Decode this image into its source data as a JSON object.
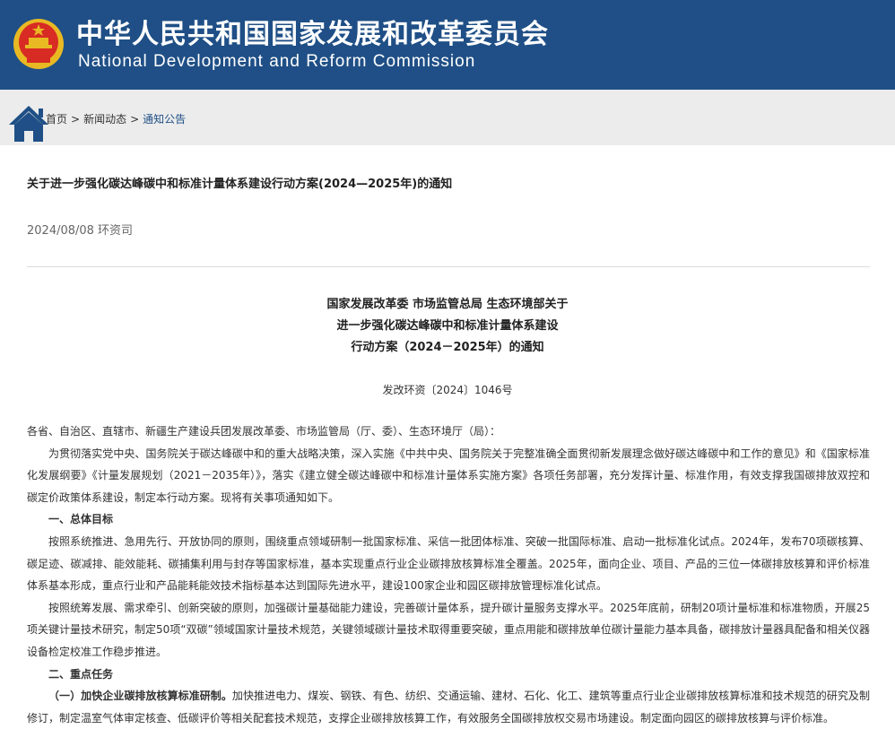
{
  "header": {
    "title_cn": "中华人民共和国国家发展和改革委员会",
    "title_en": "National Development and Reform Commission"
  },
  "breadcrumb": {
    "home": "首页",
    "sep": ">",
    "news": "新闻动态",
    "current": "通知公告"
  },
  "article": {
    "title": "关于进一步强化碳达峰碳中和标准计量体系建设行动方案(2024—2025年)的通知",
    "meta": "2024/08/08 环资司",
    "heading_lines": [
      "国家发展改革委 市场监管总局 生态环境部关于",
      "进一步强化碳达峰碳中和标准计量体系建设",
      "行动方案（2024－2025年）的通知"
    ],
    "doc_no": "发改环资〔2024〕1046号",
    "addressee": "各省、自治区、直辖市、新疆生产建设兵团发展改革委、市场监管局（厅、委）、生态环境厅（局）：",
    "intro": "为贯彻落实党中央、国务院关于碳达峰碳中和的重大战略决策，深入实施《中共中央、国务院关于完整准确全面贯彻新发展理念做好碳达峰碳中和工作的意见》和《国家标准化发展纲要》《计量发展规划（2021－2035年）》，落实《建立健全碳达峰碳中和标准计量体系实施方案》各项任务部署，充分发挥计量、标准作用，有效支撑我国碳排放双控和碳定价政策体系建设，制定本行动方案。现将有关事项通知如下。",
    "section1": "一、总体目标",
    "para1": "按照系统推进、急用先行、开放协同的原则，围绕重点领域研制一批国家标准、采信一批团体标准、突破一批国际标准、启动一批标准化试点。2024年，发布70项碳核算、碳足迹、碳减排、能效能耗、碳捕集利用与封存等国家标准，基本实现重点行业企业碳排放核算标准全覆盖。2025年，面向企业、项目、产品的三位一体碳排放核算和评价标准体系基本形成，重点行业和产品能耗能效技术指标基本达到国际先进水平，建设100家企业和园区碳排放管理标准化试点。",
    "para2": "按照统筹发展、需求牵引、创新突破的原则，加强碳计量基础能力建设，完善碳计量体系，提升碳计量服务支撑水平。2025年底前，研制20项计量标准和标准物质，开展25项关键计量技术研究，制定50项“双碳”领域国家计量技术规范，关键领域碳计量技术取得重要突破，重点用能和碳排放单位碳计量能力基本具备，碳排放计量器具配备和相关仪器设备检定校准工作稳步推进。",
    "section2": "二、重点任务",
    "task1_title": "（一）加快企业碳排放核算标准研制。",
    "task1_text": "加快推进电力、煤炭、钢铁、有色、纺织、交通运输、建材、石化、化工、建筑等重点行业企业碳排放核算标准和技术规范的研究及制修订，制定温室气体审定核查、低碳评价等相关配套技术规范，支撑企业碳排放核算工作，有效服务全国碳排放权交易市场建设。制定面向园区的碳排放核算与评价标准。"
  },
  "colors": {
    "banner": "#1f4f86",
    "crumb_bg": "#ececec",
    "link": "#1f4f86"
  },
  "icons": [
    "national-emblem-icon",
    "home-icon"
  ]
}
